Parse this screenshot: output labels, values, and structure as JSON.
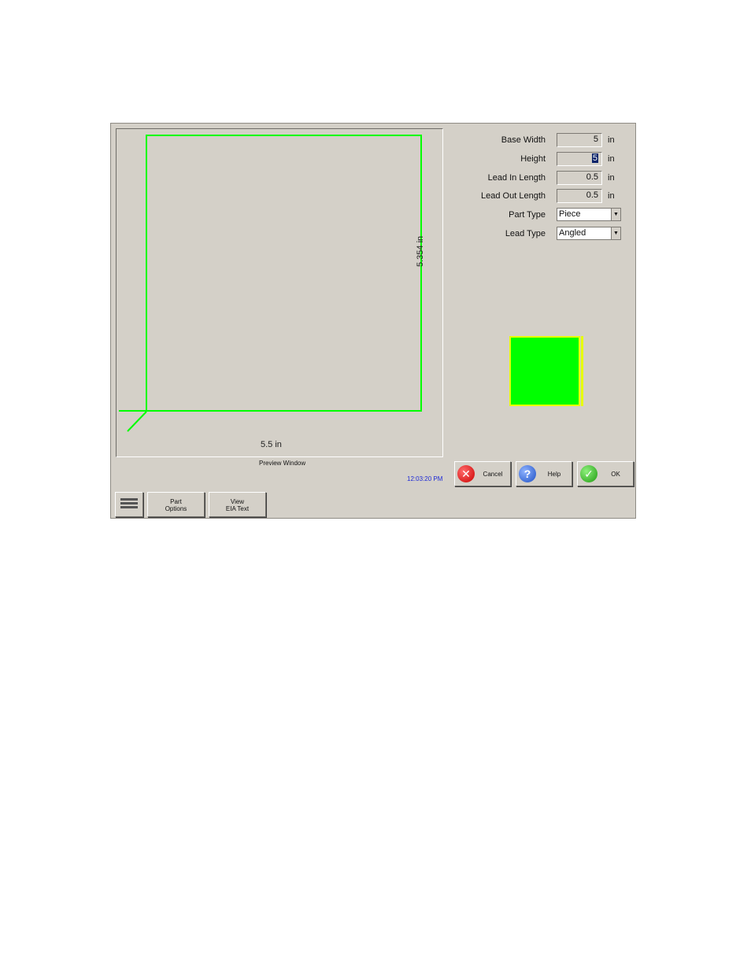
{
  "form": {
    "base_width": {
      "label": "Base Width",
      "value": "5",
      "unit": "in"
    },
    "height": {
      "label": "Height",
      "value": "5",
      "unit": "in"
    },
    "lead_in_length": {
      "label": "Lead In Length",
      "value": "0.5",
      "unit": "in"
    },
    "lead_out_length": {
      "label": "Lead Out Length",
      "value": "0.5",
      "unit": "in"
    },
    "part_type": {
      "label": "Part Type",
      "value": "Piece"
    },
    "lead_type": {
      "label": "Lead Type",
      "value": "Angled"
    }
  },
  "preview": {
    "width_dimension": "5.5 in",
    "height_dimension": "5.354 in",
    "caption": "Preview Window",
    "clock": "12:03:20 PM",
    "line_color": "#00ff00"
  },
  "thumbnail": {
    "fill_color": "#00ff00",
    "edge_color": "#e7ff00"
  },
  "buttons": {
    "cancel": "Cancel",
    "help": "Help",
    "ok": "OK"
  },
  "toolbar": {
    "keyboard_icon": "keyboard-icon",
    "part_options_line1": "Part",
    "part_options_line2": "Options",
    "view_eia_line1": "View",
    "view_eia_line2": "EIA Text"
  }
}
